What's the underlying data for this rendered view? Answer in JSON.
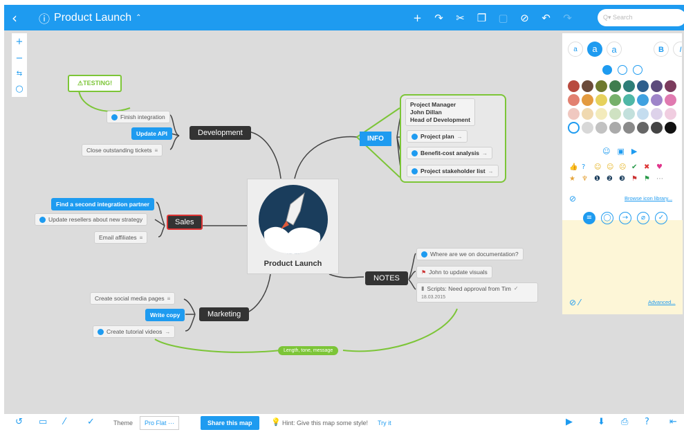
{
  "toolbar": {
    "back": "‹",
    "info_icon": "ⓘ",
    "title": "Product Launch",
    "title_caret": "⌃",
    "icons": [
      "add-icon",
      "connect-icon",
      "cut-icon",
      "copy-icon",
      "paste-icon",
      "cancel-icon",
      "undo-icon",
      "redo-icon"
    ],
    "search_placeholder": "Q▾ Search"
  },
  "zoom": {
    "plus": "+",
    "minus": "−",
    "fit": "⇆",
    "center": "○"
  },
  "map": {
    "central": "Product Launch",
    "testing": "⚠TESTING!",
    "development": {
      "label": "Development",
      "children": [
        "Finish integration",
        "Update API",
        "Close outstanding tickets"
      ]
    },
    "sales": {
      "label": "Sales",
      "children": [
        "Find a second integration partner",
        "Update resellers about new strategy",
        "Email affiliates"
      ]
    },
    "marketing": {
      "label": "Marketing",
      "children": [
        "Create social media pages",
        "Write copy",
        "Create tutorial videos"
      ]
    },
    "info": {
      "label": "INFO",
      "children": [
        "Project Manager",
        "John Dillan",
        "Head of Development",
        "Project plan",
        "Benefit-cost analysis",
        "Project stakeholder list"
      ]
    },
    "notes": {
      "label": "NOTES",
      "children": [
        "Where are we on documentation?",
        "John to update visuals",
        "Scripts: Need approval from Tim",
        "18.03.2015"
      ]
    },
    "green_link": "Length, tone, message"
  },
  "sidebar": {
    "text_styles": [
      "a",
      "a",
      "a",
      "B",
      "I"
    ],
    "colors": [
      "#b84a3f",
      "#6b4b3a",
      "#6e7a2f",
      "#3f7d4f",
      "#2f7e78",
      "#2e5f8c",
      "#5c4b7c",
      "#7b3b5d",
      "#e28070",
      "#e39a3f",
      "#e6d15c",
      "#76b06a",
      "#4fb7a6",
      "#3fa1e0",
      "#9e84c9",
      "#e07ab0",
      "#f0c8c0",
      "#f0d9b0",
      "#f3ebbc",
      "#cfe2c2",
      "#c2e0dc",
      "#c4ddef",
      "#ddd2ea",
      "#f0cde0",
      "#ffffff",
      "#d8d8d8",
      "#c2c2c2",
      "#aaaaaa",
      "#8a8a8a",
      "#666666",
      "#444444",
      "#111111"
    ],
    "browse_link": "Browse icon library...",
    "advanced_link": "Advanced..."
  },
  "bottombar": {
    "theme_label": "Theme",
    "theme_value": "Pro Flat  ···",
    "share": "Share this map",
    "hint": "Hint: Give this map some style!",
    "try_it": "Try it"
  }
}
